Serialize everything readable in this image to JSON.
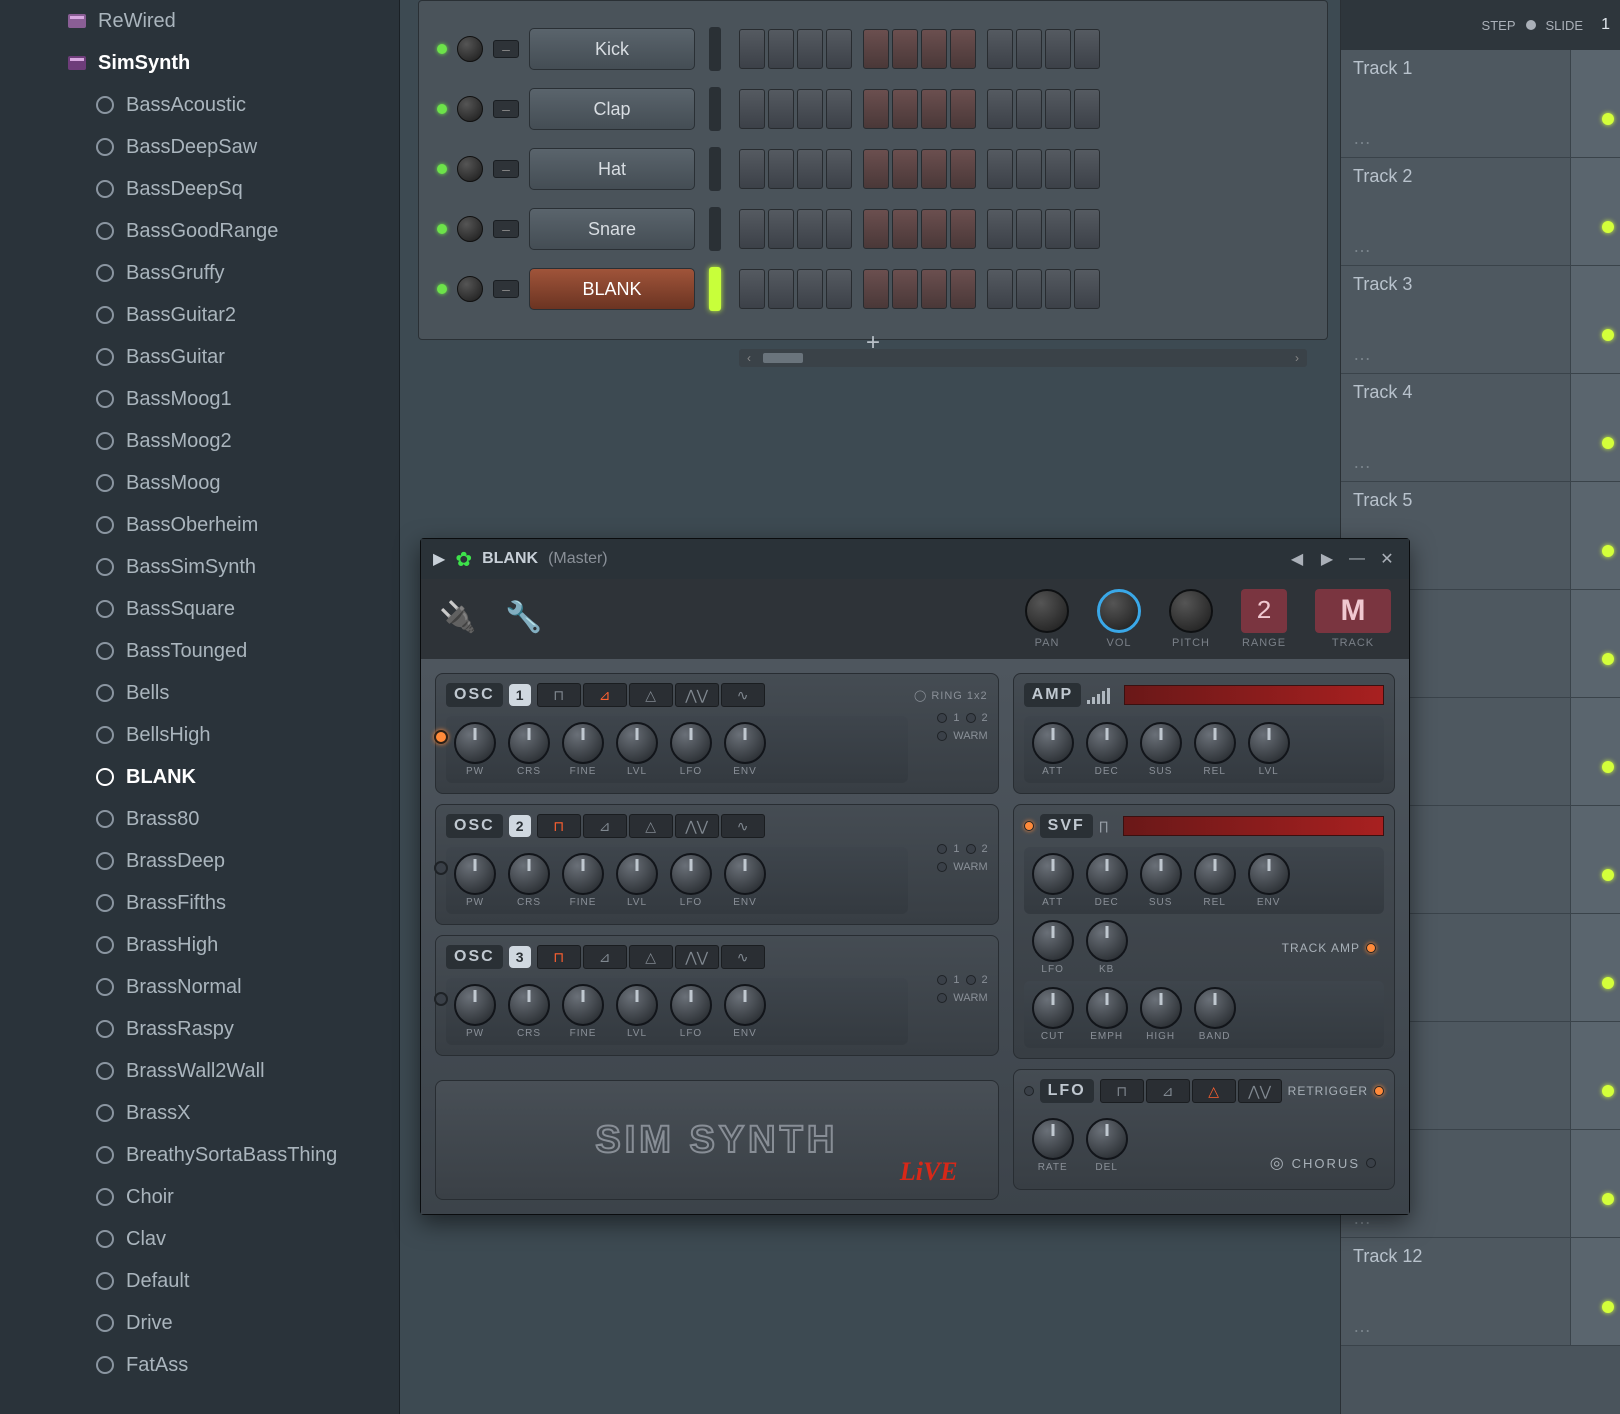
{
  "browser": {
    "folders": [
      {
        "name": "ReWired",
        "selected": false
      },
      {
        "name": "SimSynth",
        "selected": true
      }
    ],
    "presets": [
      "BassAcoustic",
      "BassDeepSaw",
      "BassDeepSq",
      "BassGoodRange",
      "BassGruffy",
      "BassGuitar2",
      "BassGuitar",
      "BassMoog1",
      "BassMoog2",
      "BassMoog",
      "BassOberheim",
      "BassSimSynth",
      "BassSquare",
      "BassTounged",
      "Bells",
      "BellsHigh",
      "BLANK",
      "Brass80",
      "BrassDeep",
      "BrassFifths",
      "BrassHigh",
      "BrassNormal",
      "BrassRaspy",
      "BrassWall2Wall",
      "BrassX",
      "BreathySortaBassThing",
      "Choir",
      "Clav",
      "Default",
      "Drive",
      "FatAss"
    ],
    "selected_preset_index": 16
  },
  "sequencer": {
    "channels": [
      {
        "name": "Kick",
        "selected": false
      },
      {
        "name": "Clap",
        "selected": false
      },
      {
        "name": "Hat",
        "selected": false
      },
      {
        "name": "Snare",
        "selected": false
      },
      {
        "name": "BLANK",
        "selected": true
      }
    ],
    "add_label": "+",
    "steps_per_group": 4,
    "groups": 3
  },
  "playlist": {
    "step_label": "STEP",
    "slide_label": "SLIDE",
    "bar_label": "1",
    "tracks": [
      "Track 1",
      "Track 2",
      "Track 3",
      "Track 4",
      "Track 5",
      "",
      "",
      "",
      "",
      "",
      "",
      "Track 12"
    ]
  },
  "plugin": {
    "title_name": "BLANK",
    "title_route": "(Master)",
    "toolbar": {
      "pan": "PAN",
      "vol": "VOL",
      "pitch": "PITCH",
      "range": "RANGE",
      "range_val": "2",
      "track": "TRACK",
      "track_val": "M"
    },
    "osc": [
      {
        "title": "OSC",
        "num": "1",
        "ring": "RING 1x2",
        "warm": "WARM",
        "knobs": [
          "PW",
          "CRS",
          "FINE",
          "LVL",
          "LFO",
          "ENV"
        ],
        "enabled": true
      },
      {
        "title": "OSC",
        "num": "2",
        "ring": "",
        "warm": "WARM",
        "knobs": [
          "PW",
          "CRS",
          "FINE",
          "LVL",
          "LFO",
          "ENV"
        ],
        "enabled": false
      },
      {
        "title": "OSC",
        "num": "3",
        "ring": "",
        "warm": "WARM",
        "knobs": [
          "PW",
          "CRS",
          "FINE",
          "LVL",
          "LFO",
          "ENV"
        ],
        "enabled": false
      }
    ],
    "amp": {
      "title": "AMP",
      "knobs": [
        "ATT",
        "DEC",
        "SUS",
        "REL",
        "LVL"
      ]
    },
    "svf": {
      "title": "SVF",
      "row1": [
        "ATT",
        "DEC",
        "SUS",
        "REL",
        "ENV"
      ],
      "row2": [
        "LFO",
        "KB"
      ],
      "row3": [
        "CUT",
        "EMPH",
        "HIGH",
        "BAND"
      ],
      "track_amp": "TRACK AMP"
    },
    "lfo": {
      "title": "LFO",
      "knobs": [
        "RATE",
        "DEL"
      ],
      "retrigger": "RETRIGGER",
      "chorus": "CHORUS"
    },
    "side_labels": {
      "one": "1",
      "two": "2"
    },
    "logo": {
      "brand": "SIM SYNTH",
      "live": "LiVE"
    }
  }
}
